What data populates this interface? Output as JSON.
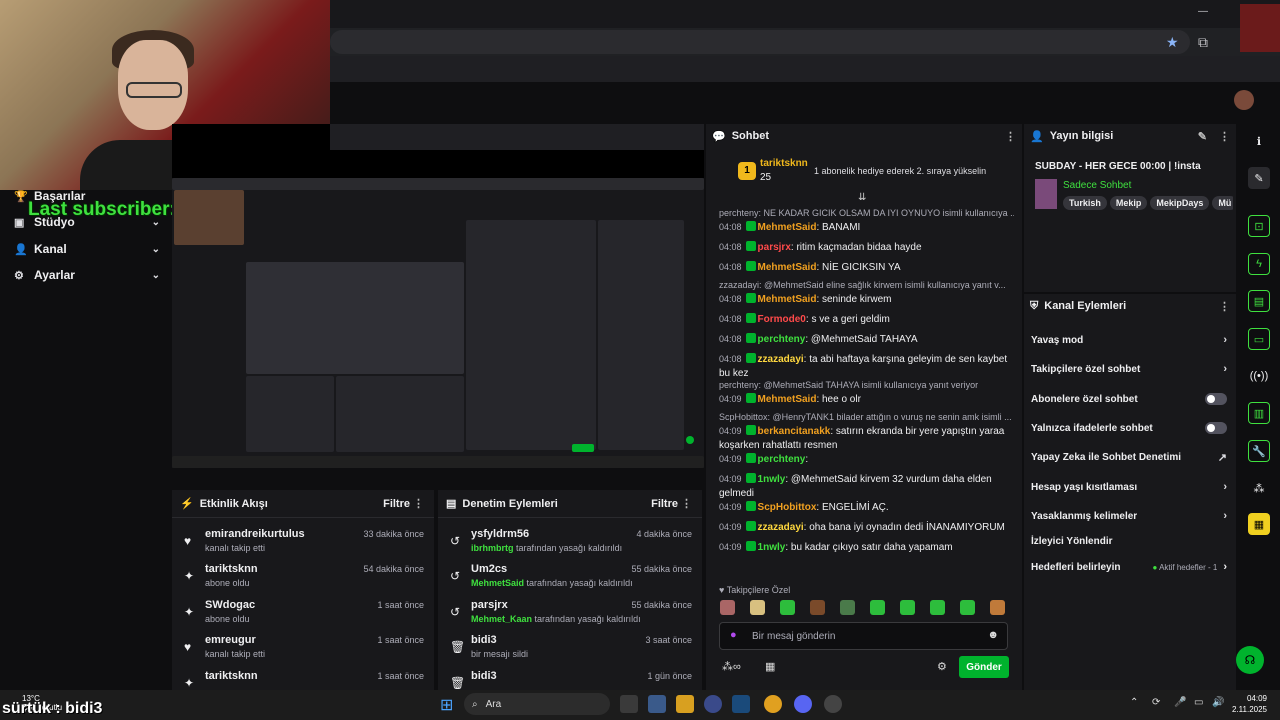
{
  "colors": {
    "accent": "#00b32d",
    "overlay_text": "#3fe03f",
    "panel": "#18181b",
    "bg": "#0e0e10"
  },
  "overlay": {
    "last_subscriber": "Last subscriber: tariktsknn",
    "bottom_text": "sürtük : bidi3"
  },
  "left_nav": {
    "items": [
      {
        "label": "Başarılar",
        "icon": "trophy-icon"
      },
      {
        "label": "Stüdyo",
        "icon": "studio-icon"
      },
      {
        "label": "Kanal",
        "icon": "channel-icon"
      },
      {
        "label": "Ayarlar",
        "icon": "gear-icon"
      }
    ]
  },
  "activity_feed": {
    "title": "Etkinlik Akışı",
    "filter_label": "Filtre",
    "items": [
      {
        "name": "emirandreikurtulus",
        "desc": "kanalı takip etti",
        "time": "33 dakika önce",
        "icon": "heart-icon"
      },
      {
        "name": "tariktsknn",
        "desc": "abone oldu",
        "time": "54 dakika önce",
        "icon": "star-icon"
      },
      {
        "name": "SWdogac",
        "desc": "abone oldu",
        "time": "1 saat önce",
        "icon": "star-icon"
      },
      {
        "name": "emreugur",
        "desc": "kanalı takip etti",
        "time": "1 saat önce",
        "icon": "heart-icon"
      },
      {
        "name": "tariktsknn",
        "desc": "",
        "time": "1 saat önce",
        "icon": "star-icon"
      }
    ]
  },
  "moderation": {
    "title": "Denetim Eylemleri",
    "filter_label": "Filtre",
    "items": [
      {
        "name": "ysfyldrm56",
        "actor": "ibrhmbrtg",
        "desc": "tarafından yasağı kaldırıldı",
        "time": "4 dakika önce",
        "icon": "undo-icon"
      },
      {
        "name": "Um2cs",
        "actor": "MehmetSaid",
        "desc": "tarafından yasağı kaldırıldı",
        "time": "55 dakika önce",
        "icon": "undo-icon"
      },
      {
        "name": "parsjrx",
        "actor": "Mehmet_Kaan",
        "desc": "tarafından yasağı kaldırıldı",
        "time": "55 dakika önce",
        "icon": "undo-icon"
      },
      {
        "name": "bidi3",
        "actor": "",
        "desc": "bir mesajı sildi",
        "time": "3 saat önce",
        "icon": "trash-icon"
      },
      {
        "name": "bidi3",
        "actor": "",
        "desc": "",
        "time": "1 gün önce",
        "icon": "trash-icon"
      }
    ]
  },
  "chat": {
    "title": "Sohbet",
    "pinned_user": "tariktsknn",
    "pinned_count": "25",
    "pinned_text": "1 abonelik hediye ederek 2. sıraya yükselin",
    "messages": [
      {
        "type": "reply",
        "text": "perchteny: NE KADAR GICIK OLSAM DA IYI OYNUYO isimli kullanıcıya ..."
      },
      {
        "type": "msg",
        "time": "04:08",
        "user": "MehmetSaid",
        "color": "#f0a020",
        "text": "BANAMI"
      },
      {
        "type": "msg",
        "time": "04:08",
        "user": "parsjrx",
        "color": "#ff4a4a",
        "text": "ritim kaçmadan bidaa hayde"
      },
      {
        "type": "msg",
        "time": "04:08",
        "user": "MehmetSaid",
        "color": "#f0a020",
        "text": "NİE GICIKSIN YA"
      },
      {
        "type": "reply",
        "text": "zzazadayi: @MehmetSaid eline sağlık kirwem isimli kullanıcıya yanıt v..."
      },
      {
        "type": "msg",
        "time": "04:08",
        "user": "MehmetSaid",
        "color": "#f0a020",
        "text": "seninde kirwem"
      },
      {
        "type": "msg",
        "time": "04:08",
        "user": "Formode0",
        "color": "#ff4a4a",
        "text": "s ve a geri geldim"
      },
      {
        "type": "msg",
        "time": "04:08",
        "user": "perchteny",
        "color": "#3fe03f",
        "text": "@MehmetSaid TAHAYA"
      },
      {
        "type": "msg",
        "time": "04:08",
        "user": "zzazadayi",
        "color": "#ffd83f",
        "text": "ta abi haftaya karşına geleyim de sen kaybet bu kez"
      },
      {
        "type": "reply",
        "text": "perchteny: @MehmetSaid TAHAYA isimli kullanıcıya yanıt veriyor"
      },
      {
        "type": "msg",
        "time": "04:09",
        "user": "MehmetSaid",
        "color": "#f0a020",
        "text": "hee o olr"
      },
      {
        "type": "reply",
        "text": "ScpHobittox: @HenryTANK1 bilader attığın o vuruş ne senin amk isimli ..."
      },
      {
        "type": "msg",
        "time": "04:09",
        "user": "berkancitanakk",
        "color": "#f0a020",
        "text": "satırın ekranda bir yere yapıştın yaraa koşarken rahatlattı resmen"
      },
      {
        "type": "msg",
        "time": "04:09",
        "user": "perchteny",
        "color": "#3fe03f",
        "text": ""
      },
      {
        "type": "msg",
        "time": "04:09",
        "user": "1nwly",
        "color": "#3fe03f",
        "text": "@MehmetSaid kirvem 32 vurdum daha elden gelmedi"
      },
      {
        "type": "msg",
        "time": "04:09",
        "user": "ScpHobittox",
        "color": "#f0a020",
        "text": "ENGELİMİ AÇ."
      },
      {
        "type": "msg",
        "time": "04:09",
        "user": "zzazadayi",
        "color": "#ffd83f",
        "text": "oha bana iyi oynadın dedi İNANAMIYORUM"
      },
      {
        "type": "msg",
        "time": "04:09",
        "user": "1nwly",
        "color": "#3fe03f",
        "text": "bu kadar çıkıyo satır daha yapamam"
      }
    ],
    "emote_label": "Takipçilere Özel",
    "input_placeholder": "Bir mesaj gönderin",
    "send_label": "Gönder"
  },
  "stream_info": {
    "title": "Yayın bilgisi",
    "stream_title": "SUBDAY - HER GECE 00:00 | !insta",
    "category": "Sadece Sohbet",
    "tags": [
      "Turkish",
      "Mekip",
      "MekipDays",
      "Mü"
    ]
  },
  "channel_actions": {
    "title": "Kanal Eylemleri",
    "items": [
      {
        "label": "Yavaş mod",
        "control": "chevron"
      },
      {
        "label": "Takipçilere özel sohbet",
        "control": "chevron"
      },
      {
        "label": "Abonelere özel sohbet",
        "control": "toggle"
      },
      {
        "label": "Yalnızca ifadelerle sohbet",
        "control": "toggle"
      },
      {
        "label": "Yapay Zeka ile Sohbet Denetimi",
        "control": "external"
      },
      {
        "label": "Hesap yaşı kısıtlaması",
        "control": "chevron"
      },
      {
        "label": "Yasaklanmış kelimeler",
        "control": "chevron"
      },
      {
        "label": "İzleyici Yönlendir",
        "control": "none"
      },
      {
        "label": "Hedefleri belirleyin",
        "control": "chevron"
      }
    ],
    "goals_status": "Aktif hedefler - 1"
  },
  "taskbar": {
    "search_label": "Ara",
    "weather": "13°C",
    "weather_sub": "Çok bulutlu",
    "time": "04:09",
    "date": "2.11.2025"
  }
}
